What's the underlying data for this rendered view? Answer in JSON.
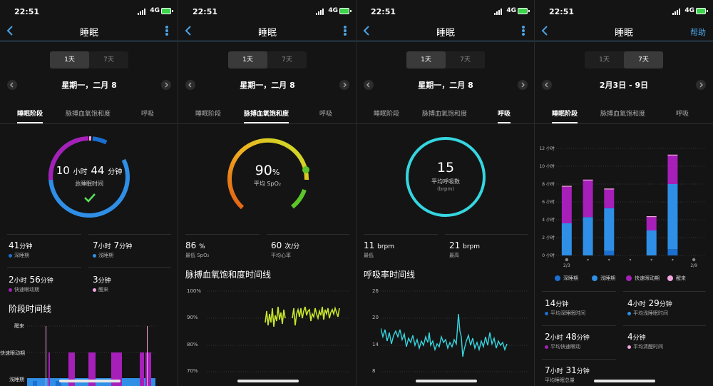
{
  "status_time": "22:51",
  "network": "4G",
  "colors": {
    "deep": "#1a6fd0",
    "light": "#2f8fe6",
    "rem": "#a61fb8",
    "awake": "#f3a6e0",
    "accent": "#4aa3e6",
    "spo2_lo": "#e67a1a",
    "spo2_hi": "#c6e52a",
    "resp": "#35d6e0"
  },
  "screens": [
    {
      "header": {
        "title": "睡眠"
      },
      "segment": {
        "day": "1天",
        "week": "7天"
      },
      "date": "星期一，二月 8",
      "tabs": [
        "睡眠阶段",
        "脉搏血氧饱和度",
        "呼吸"
      ],
      "ring": {
        "hours": "10",
        "hours_unit": "小时",
        "minutes": "44",
        "minutes_unit": "分钟",
        "label": "总睡眠时间"
      },
      "stats": [
        {
          "value": "41",
          "unit": "分钟",
          "label": "深睡期"
        },
        {
          "value": "7",
          "unit": "小时",
          "value2": "7",
          "unit2": "分钟",
          "label": "浅睡期"
        },
        {
          "value": "2",
          "unit": "小时",
          "value2": "56",
          "unit2": "分钟",
          "label": "快速眼动期"
        },
        {
          "value": "3",
          "unit": "分钟",
          "label": "醒来"
        }
      ],
      "timeline_title": "阶段时间线",
      "timeline_levels": [
        "醒来",
        "快速眼动期",
        "浅睡期"
      ]
    },
    {
      "header": {
        "title": "睡眠"
      },
      "segment": {
        "day": "1天",
        "week": "7天"
      },
      "date": "星期一，二月 8",
      "tabs": [
        "睡眠阶段",
        "脉搏血氧饱和度",
        "呼吸"
      ],
      "ring": {
        "value": "90",
        "unit": "%",
        "label": "平均 SpO₂"
      },
      "stats": [
        {
          "value": "86",
          "unit": "%",
          "label": "最低 SpO₂"
        },
        {
          "value": "60",
          "unit": "次/分",
          "label": "平均心率"
        }
      ],
      "timeline_title": "脉搏血氧饱和度时间线",
      "y_ticks": [
        "100%",
        "90%",
        "80%",
        "70%"
      ]
    },
    {
      "header": {
        "title": "睡眠"
      },
      "segment": {
        "day": "1天",
        "week": "7天"
      },
      "date": "星期一，二月 8",
      "tabs": [
        "睡眠阶段",
        "脉搏血氧饱和度",
        "呼吸"
      ],
      "ring": {
        "value": "15",
        "label": "平均呼吸数",
        "unit": "(brpm)"
      },
      "stats": [
        {
          "value": "11",
          "unit": "brpm",
          "label": "最低"
        },
        {
          "value": "21",
          "unit": "brpm",
          "label": "最高"
        }
      ],
      "timeline_title": "呼吸率时间线",
      "y_ticks": [
        "26",
        "20",
        "14",
        "8"
      ]
    },
    {
      "header": {
        "title": "睡眠",
        "help": "帮助"
      },
      "segment": {
        "day": "1天",
        "week": "7天"
      },
      "date": "2月3日 - 9日",
      "tabs": [
        "睡眠阶段",
        "脉搏血氧饱和度",
        "呼吸"
      ],
      "chart_data": {
        "type": "bar",
        "stacked": true,
        "categories": [
          "2/3",
          "",
          "",
          "",
          "",
          "",
          "2/9"
        ],
        "y_ticks": [
          "12 小时",
          "10 小时",
          "8 小时",
          "6 小时",
          "4 小时",
          "2 小时",
          "0 小时"
        ],
        "ylim": [
          0,
          12
        ],
        "legend_position": "bottom",
        "series": [
          {
            "name": "深睡期",
            "values": [
              0,
              0,
              0.5,
              0,
              0,
              0.7,
              0
            ]
          },
          {
            "name": "浅睡期",
            "values": [
              3.6,
              4.3,
              4.8,
              0,
              2.8,
              7.3,
              0
            ]
          },
          {
            "name": "快速眼动期",
            "values": [
              4.1,
              4.1,
              2.1,
              0,
              1.5,
              3.2,
              0
            ]
          },
          {
            "name": "醒来",
            "values": [
              0.1,
              0.1,
              0.1,
              0,
              0.1,
              0.1,
              0
            ]
          }
        ]
      },
      "stats": [
        {
          "value": "14",
          "unit": "分钟",
          "label": "平均深睡眠时间"
        },
        {
          "value": "4",
          "unit": "小时",
          "value2": "29",
          "unit2": "分钟",
          "label": "平均浅睡眠时间"
        },
        {
          "value": "2",
          "unit": "小时",
          "value2": "48",
          "unit2": "分钟",
          "label": "平均快速眼动"
        },
        {
          "value": "4",
          "unit": "分钟",
          "label": "平均清醒时间"
        },
        {
          "value": "7",
          "unit": "小时",
          "value2": "31",
          "unit2": "分钟",
          "label": "平均睡眠总量"
        }
      ]
    }
  ]
}
